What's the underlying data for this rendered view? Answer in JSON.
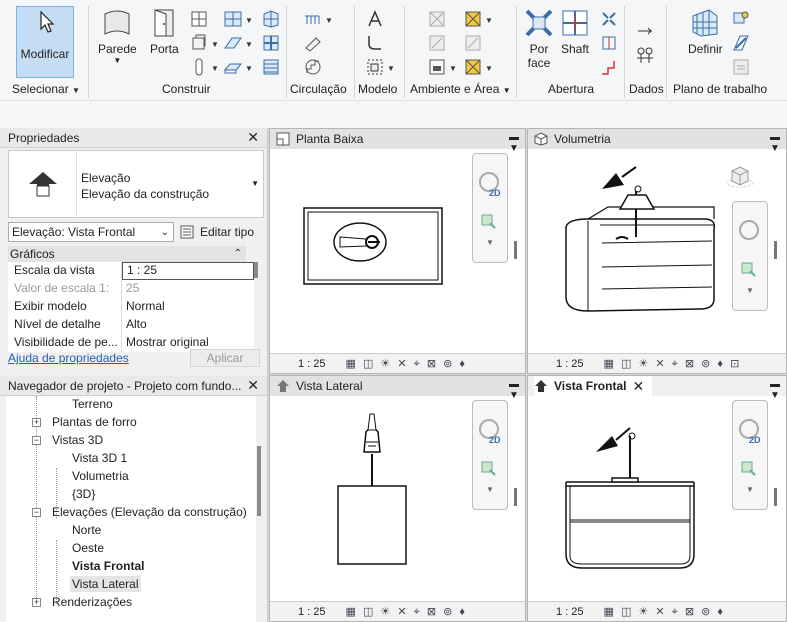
{
  "ribbon": {
    "modificar": "Modificar",
    "selecionar": "Selecionar",
    "parede": "Parede",
    "porta": "Porta",
    "construir": "Construir",
    "circulacao": "Circulação",
    "modelo": "Modelo",
    "ambiente_area": "Ambiente e Área",
    "por_face": "Por\nface",
    "shaft": "Shaft",
    "abertura": "Abertura",
    "dados": "Dados",
    "definir": "Definir",
    "plano_trabalho": "Plano de trabalho"
  },
  "properties": {
    "title": "Propriedades",
    "type_line1": "Elevação",
    "type_line2": "Elevação da construção",
    "selector": "Elevação: Vista Frontal",
    "edit_type": "Editar tipo",
    "section": "Gráficos",
    "rows": [
      {
        "k": "Escala da vista",
        "v": "1 : 25"
      },
      {
        "k": "Valor de escala    1:",
        "v": "25"
      },
      {
        "k": "Exibir modelo",
        "v": "Normal"
      },
      {
        "k": "Nível de detalhe",
        "v": "Alto"
      },
      {
        "k": "Visibilidade de pe...",
        "v": "Mostrar original"
      }
    ],
    "help_link": "Ajuda de propriedades",
    "apply": "Aplicar"
  },
  "browser": {
    "title": "Navegador de projeto - Projeto com fundo...",
    "items": [
      "Terreno",
      "Plantas de forro",
      "Vistas 3D",
      "Vista 3D 1",
      "Volumetria",
      "{3D}",
      "Elevações (Elevação da construção)",
      "Norte",
      "Oeste",
      "Vista Frontal",
      "Vista Lateral",
      "Renderizações"
    ]
  },
  "views": {
    "planta": "Planta Baixa",
    "volumetria": "Volumetria",
    "lateral": "Vista Lateral",
    "frontal": "Vista Frontal",
    "scale": "1 : 25",
    "nav2d": "2D"
  },
  "colors": {
    "accent": "#c5dcf5",
    "link": "#1e5fb3"
  }
}
